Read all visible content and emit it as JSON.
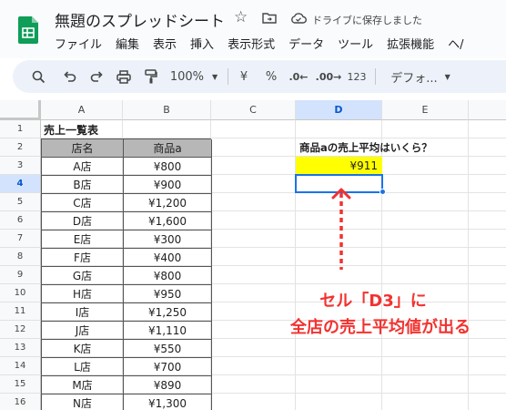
{
  "doc": {
    "title": "無題のスプレッドシート",
    "saved_status": "ドライブに保存しました"
  },
  "menu": [
    "ファイル",
    "編集",
    "表示",
    "挿入",
    "表示形式",
    "データ",
    "ツール",
    "拡張機能",
    "ヘ/"
  ],
  "toolbar": {
    "zoom": "100%",
    "currency": "¥",
    "percent": "%",
    "dec_decrease": ".0←",
    "dec_increase": ".00→",
    "number_format": "123",
    "font": "デフォ..."
  },
  "columns": [
    "A",
    "B",
    "C",
    "D",
    "E"
  ],
  "rows": [
    "1",
    "2",
    "3",
    "4",
    "5",
    "6",
    "7",
    "8",
    "9",
    "10",
    "11",
    "12",
    "13",
    "14",
    "15",
    "16"
  ],
  "sheet": {
    "table_title": "売上一覧表",
    "header_store": "店名",
    "header_product": "商品a",
    "stores": [
      "A店",
      "B店",
      "C店",
      "D店",
      "E店",
      "F店",
      "G店",
      "H店",
      "I店",
      "J店",
      "K店",
      "L店",
      "M店",
      "N店"
    ],
    "sales": [
      "¥800",
      "¥900",
      "¥1,200",
      "¥1,600",
      "¥300",
      "¥400",
      "¥800",
      "¥950",
      "¥1,250",
      "¥1,110",
      "¥550",
      "¥700",
      "¥890",
      "¥1,300"
    ],
    "question": "商品aの売上平均はいくら？",
    "average": "¥911"
  },
  "annotation": {
    "line1": "セル「D3」に",
    "line2": "全店の売上平均値が出る"
  },
  "colors": {
    "accent": "#1a73e8",
    "highlight": "#ffff00",
    "annotation": "#f2322f",
    "header_fill": "#b7b7b7"
  }
}
